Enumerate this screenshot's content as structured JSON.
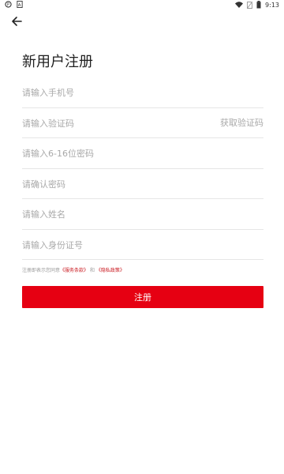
{
  "status_bar": {
    "left_icons": [
      "p-circle-icon",
      "a-icon"
    ],
    "time": "9:13"
  },
  "header": {
    "back_icon": "arrow-left-icon",
    "title": "新用户注册"
  },
  "form": {
    "phone_placeholder": "请输入手机号",
    "code_placeholder": "请输入验证码",
    "get_code_label": "获取验证码",
    "password_placeholder": "请输入6-16位密码",
    "confirm_password_placeholder": "请确认密码",
    "name_placeholder": "请输入姓名",
    "id_number_placeholder": "请输入身份证号"
  },
  "agreement": {
    "prefix": "注册即表示您同意",
    "terms_link": "《服务条款》",
    "conjunction": "和",
    "privacy_link": "《隐私政策》"
  },
  "register_button_label": "注册",
  "colors": {
    "accent": "#e60012",
    "link": "#c9171e",
    "placeholder": "#a9a9a9",
    "divider": "#e6e6e6"
  }
}
